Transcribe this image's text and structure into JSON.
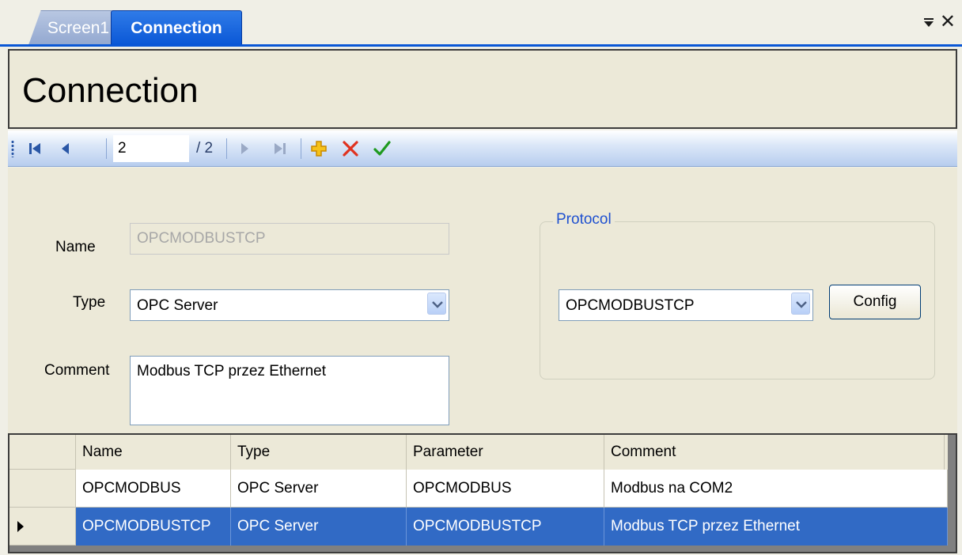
{
  "tabs": [
    {
      "label": "Screen1"
    },
    {
      "label": "Connection"
    }
  ],
  "header": {
    "title": "Connection"
  },
  "navigator": {
    "current_record": "2",
    "total": "/ 2"
  },
  "form": {
    "name_label": "Name",
    "name_value": "OPCMODBUSTCP",
    "type_label": "Type",
    "type_value": "OPC Server",
    "comment_label": "Comment",
    "comment_value": "Modbus TCP przez Ethernet",
    "protocol_legend": "Protocol",
    "protocol_value": "OPCMODBUSTCP",
    "config_label": "Config"
  },
  "grid": {
    "columns": [
      "Name",
      "Type",
      "Parameter",
      "Comment"
    ],
    "rows": [
      [
        "OPCMODBUS",
        "OPC Server",
        "OPCMODBUS",
        "Modbus na COM2"
      ],
      [
        "OPCMODBUSTCP",
        "OPC Server",
        "OPCMODBUSTCP",
        "Modbus TCP przez Ethernet"
      ]
    ],
    "selected_row": 1
  },
  "colors": {
    "accent": "#0a57d6",
    "selection": "#316ac5",
    "delete": "#e0321f",
    "confirm": "#1f9a1f",
    "add": "#f0b000"
  }
}
